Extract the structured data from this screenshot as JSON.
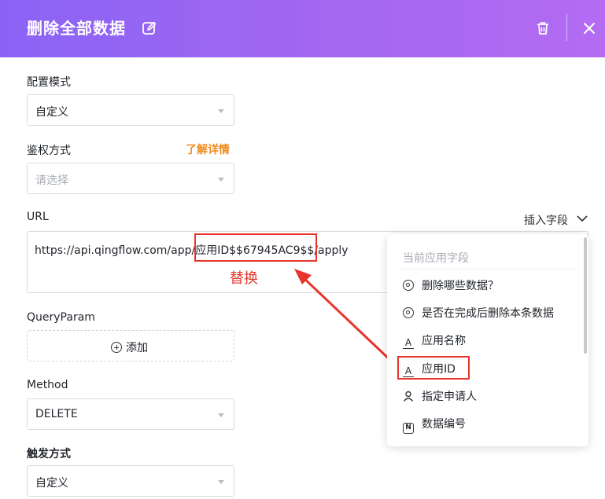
{
  "header": {
    "title": "删除全部数据",
    "edit_icon": "edit-icon",
    "trash_icon": "trash-icon",
    "close_icon": "close-icon"
  },
  "config_mode": {
    "label": "配置模式",
    "value": "自定义"
  },
  "auth": {
    "label": "鉴权方式",
    "link": "了解详情",
    "placeholder": "请选择"
  },
  "url": {
    "label": "URL",
    "insert_field": "插入字段",
    "prefix": "https://api.qingflow.com/app/",
    "tag": "应用ID$$67945AC9$$",
    "suffix": "/apply",
    "annotation": "替换"
  },
  "query": {
    "label": "QueryParam",
    "add": "添加"
  },
  "method": {
    "label": "Method",
    "value": "DELETE"
  },
  "trigger": {
    "label": "触发方式",
    "value": "自定义"
  },
  "dropdown": {
    "header": "当前应用字段",
    "items": [
      {
        "label": "删除哪些数据？",
        "icon": "radio-icon"
      },
      {
        "label": "是否在完成后删除本条数据",
        "icon": "radio-icon"
      },
      {
        "label": "应用名称",
        "icon": "text-field-icon"
      },
      {
        "label": "应用ID",
        "icon": "text-field-icon"
      },
      {
        "label": "指定申请人",
        "icon": "person-icon"
      },
      {
        "label": "数据编号",
        "icon": "number-icon"
      }
    ]
  },
  "colors": {
    "header_start": "#8a63f5",
    "header_end": "#b36bf2",
    "accent_orange": "#f08a1c",
    "annotation_red": "#e8352b"
  }
}
